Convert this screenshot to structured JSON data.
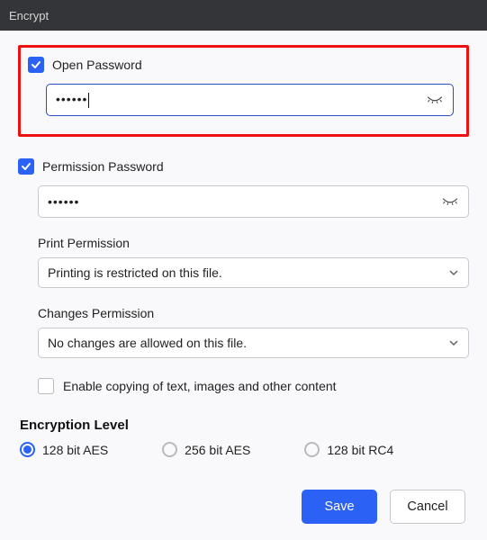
{
  "title": "Encrypt",
  "open_password": {
    "checkbox_label": "Open Password",
    "checked": true,
    "value": "••••••"
  },
  "permission_password": {
    "checkbox_label": "Permission Password",
    "checked": true,
    "value": "••••••"
  },
  "print_permission": {
    "label": "Print Permission",
    "value": "Printing is restricted on this file."
  },
  "changes_permission": {
    "label": "Changes Permission",
    "value": "No changes are allowed on this file."
  },
  "enable_copy": {
    "checked": false,
    "label": "Enable copying of text, images and other content"
  },
  "encryption_level": {
    "title": "Encryption Level",
    "options": [
      "128 bit AES",
      "256 bit AES",
      "128 bit RC4"
    ],
    "selected": 0
  },
  "buttons": {
    "save": "Save",
    "cancel": "Cancel"
  }
}
